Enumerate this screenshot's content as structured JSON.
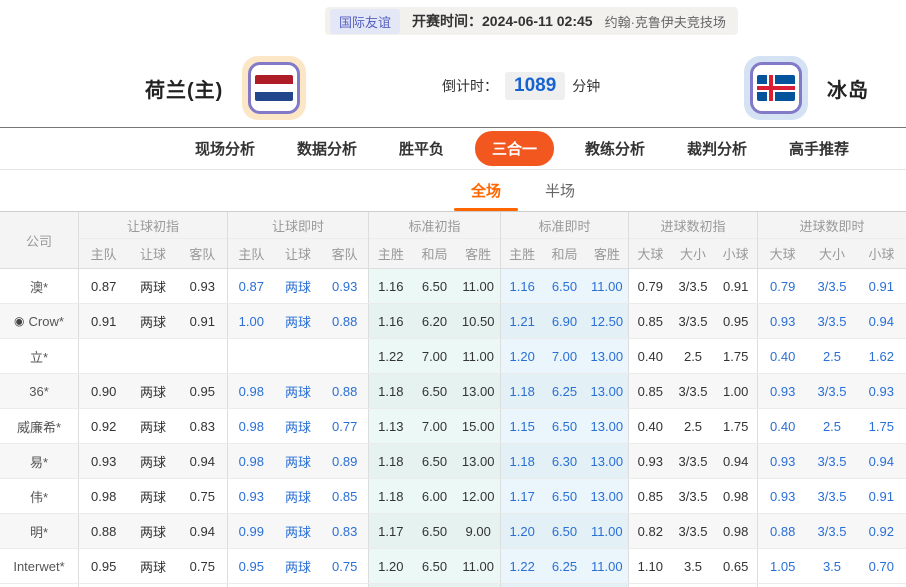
{
  "top_bar": {
    "league": "国际友谊",
    "kickoff_label": "开赛时间：",
    "kickoff_time": "2024-06-11 02:45",
    "venue": "约翰·克鲁伊夫竞技场"
  },
  "match": {
    "home_team": "荷兰(主)",
    "away_team": "冰岛",
    "home_flag": "netherlands-flag",
    "away_flag": "iceland-flag",
    "countdown_label": "倒计时：",
    "countdown_value": "1089",
    "countdown_unit": "分钟"
  },
  "nav": {
    "tabs": [
      {
        "label": "现场分析",
        "active": false
      },
      {
        "label": "数据分析",
        "active": false
      },
      {
        "label": "胜平负",
        "active": false
      },
      {
        "label": "三合一",
        "active": true
      },
      {
        "label": "教练分析",
        "active": false
      },
      {
        "label": "裁判分析",
        "active": false
      },
      {
        "label": "高手推荐",
        "active": false
      }
    ]
  },
  "subtabs": [
    {
      "label": "全场",
      "active": true
    },
    {
      "label": "半场",
      "active": false
    }
  ],
  "odds_table": {
    "company_header": "公司",
    "groups": [
      {
        "label": "让球初指",
        "cols": [
          "主队",
          "让球",
          "客队"
        ]
      },
      {
        "label": "让球即时",
        "cols": [
          "主队",
          "让球",
          "客队"
        ]
      },
      {
        "label": "标准初指",
        "cols": [
          "主胜",
          "和局",
          "客胜"
        ]
      },
      {
        "label": "标准即时",
        "cols": [
          "主胜",
          "和局",
          "客胜"
        ]
      },
      {
        "label": "进球数初指",
        "cols": [
          "大球",
          "大小",
          "小球"
        ]
      },
      {
        "label": "进球数即时",
        "cols": [
          "大球",
          "大小",
          "小球"
        ]
      }
    ],
    "rows": [
      {
        "company": "澳*",
        "icon": "",
        "groups": [
          [
            "0.87",
            "两球",
            "0.93"
          ],
          [
            "0.87",
            "两球",
            "0.93"
          ],
          [
            "1.16",
            "6.50",
            "11.00"
          ],
          [
            "1.16",
            "6.50",
            "11.00"
          ],
          [
            "0.79",
            "3/3.5",
            "0.91"
          ],
          [
            "0.79",
            "3/3.5",
            "0.91"
          ]
        ]
      },
      {
        "company": "Crow*",
        "icon": "football-icon",
        "groups": [
          [
            "0.91",
            "两球",
            "0.91"
          ],
          [
            "1.00",
            "两球",
            "0.88"
          ],
          [
            "1.16",
            "6.20",
            "10.50"
          ],
          [
            "1.21",
            "6.90",
            "12.50"
          ],
          [
            "0.85",
            "3/3.5",
            "0.95"
          ],
          [
            "0.93",
            "3/3.5",
            "0.94"
          ]
        ]
      },
      {
        "company": "立*",
        "icon": "",
        "groups": [
          [
            "",
            "",
            ""
          ],
          [
            "",
            "",
            ""
          ],
          [
            "1.22",
            "7.00",
            "11.00"
          ],
          [
            "1.20",
            "7.00",
            "13.00"
          ],
          [
            "0.40",
            "2.5",
            "1.75"
          ],
          [
            "0.40",
            "2.5",
            "1.62"
          ]
        ]
      },
      {
        "company": "36*",
        "icon": "",
        "groups": [
          [
            "0.90",
            "两球",
            "0.95"
          ],
          [
            "0.98",
            "两球",
            "0.88"
          ],
          [
            "1.18",
            "6.50",
            "13.00"
          ],
          [
            "1.18",
            "6.25",
            "13.00"
          ],
          [
            "0.85",
            "3/3.5",
            "1.00"
          ],
          [
            "0.93",
            "3/3.5",
            "0.93"
          ]
        ]
      },
      {
        "company": "威廉希*",
        "icon": "",
        "groups": [
          [
            "0.92",
            "两球",
            "0.83"
          ],
          [
            "0.98",
            "两球",
            "0.77"
          ],
          [
            "1.13",
            "7.00",
            "15.00"
          ],
          [
            "1.15",
            "6.50",
            "13.00"
          ],
          [
            "0.40",
            "2.5",
            "1.75"
          ],
          [
            "0.40",
            "2.5",
            "1.75"
          ]
        ]
      },
      {
        "company": "易*",
        "icon": "",
        "groups": [
          [
            "0.93",
            "两球",
            "0.94"
          ],
          [
            "0.98",
            "两球",
            "0.89"
          ],
          [
            "1.18",
            "6.50",
            "13.00"
          ],
          [
            "1.18",
            "6.30",
            "13.00"
          ],
          [
            "0.93",
            "3/3.5",
            "0.94"
          ],
          [
            "0.93",
            "3/3.5",
            "0.94"
          ]
        ]
      },
      {
        "company": "伟*",
        "icon": "",
        "groups": [
          [
            "0.98",
            "两球",
            "0.75"
          ],
          [
            "0.93",
            "两球",
            "0.85"
          ],
          [
            "1.18",
            "6.00",
            "12.00"
          ],
          [
            "1.17",
            "6.50",
            "13.00"
          ],
          [
            "0.85",
            "3/3.5",
            "0.98"
          ],
          [
            "0.93",
            "3/3.5",
            "0.91"
          ]
        ]
      },
      {
        "company": "明*",
        "icon": "",
        "groups": [
          [
            "0.88",
            "两球",
            "0.94"
          ],
          [
            "0.99",
            "两球",
            "0.83"
          ],
          [
            "1.17",
            "6.50",
            "9.00"
          ],
          [
            "1.20",
            "6.50",
            "11.00"
          ],
          [
            "0.82",
            "3/3.5",
            "0.98"
          ],
          [
            "0.88",
            "3/3.5",
            "0.92"
          ]
        ]
      },
      {
        "company": "Interwet*",
        "icon": "",
        "groups": [
          [
            "0.95",
            "两球",
            "0.75"
          ],
          [
            "0.95",
            "两球",
            "0.75"
          ],
          [
            "1.20",
            "6.50",
            "11.00"
          ],
          [
            "1.22",
            "6.25",
            "11.00"
          ],
          [
            "1.10",
            "3.5",
            "0.65"
          ],
          [
            "1.05",
            "3.5",
            "0.70"
          ]
        ]
      }
    ]
  },
  "colors": {
    "accent_orange": "#f2571f",
    "subtab_orange": "#ff6600",
    "odds_blue": "#2a6fd6",
    "countdown_blue": "#1763d0",
    "badge_text_blue": "#5560c0",
    "flag_nl_red": "#ae1c28",
    "flag_nl_blue": "#21468b",
    "flag_is_blue": "#02529c",
    "flag_is_red": "#dc1e35"
  }
}
